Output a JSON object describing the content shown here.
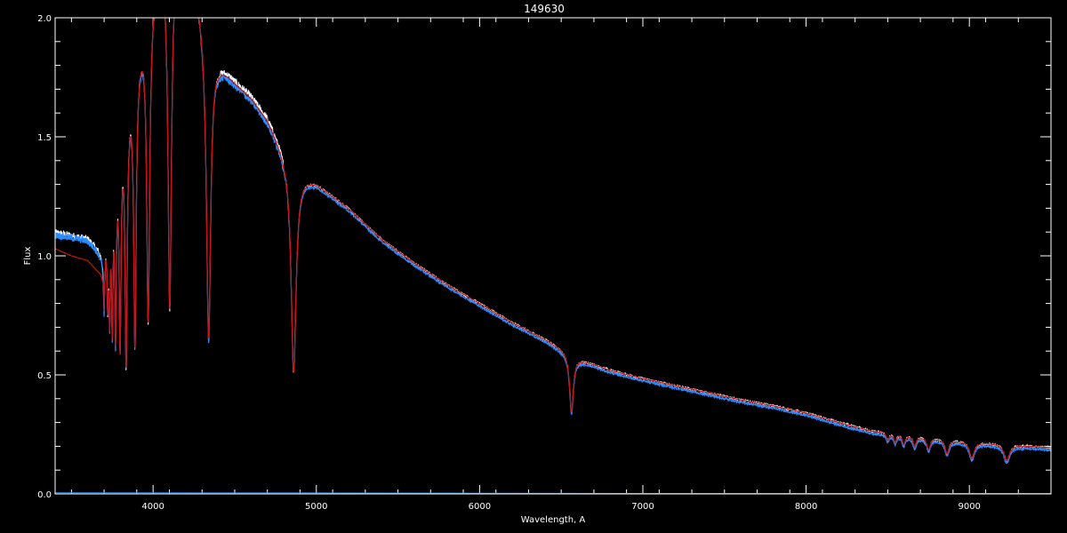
{
  "chart_data": {
    "type": "line",
    "title": "149630",
    "xlabel": "Wavelength, A",
    "ylabel": "Flux",
    "xlim": [
      3400,
      9500
    ],
    "ylim": [
      0.0,
      2.0
    ],
    "xticks": [
      4000,
      5000,
      6000,
      7000,
      8000,
      9000
    ],
    "yticks": [
      0.0,
      0.5,
      1.0,
      1.5,
      2.0
    ],
    "xtick_labels": [
      "4000",
      "5000",
      "6000",
      "7000",
      "8000",
      "9000"
    ],
    "ytick_labels": [
      "0.0",
      "0.5",
      "1.0",
      "1.5",
      "2.0"
    ],
    "grid": false,
    "colors": {
      "background": "#000000",
      "axes": "#ffffff",
      "observed": "#ffffff",
      "observed_alt": "#2a8cff",
      "model": "#cc1010"
    },
    "continuum": {
      "x": [
        3400,
        3600,
        3700,
        3720,
        3800,
        3900,
        4000,
        4100,
        4200,
        4300,
        4400,
        4500,
        4600,
        4700,
        4800,
        4900,
        5000,
        5200,
        5400,
        5600,
        5800,
        6000,
        6200,
        6400,
        6600,
        6800,
        7000,
        7200,
        7400,
        7600,
        7800,
        8000,
        8200,
        8400,
        8600,
        8800,
        9000,
        9200,
        9400,
        9500
      ],
      "y": [
        1.1,
        1.08,
        1.02,
        1.22,
        1.55,
        1.85,
        2.15,
        2.35,
        2.3,
        2.05,
        1.83,
        1.74,
        1.67,
        1.58,
        1.44,
        1.35,
        1.31,
        1.2,
        1.07,
        0.97,
        0.88,
        0.8,
        0.72,
        0.65,
        0.57,
        0.52,
        0.485,
        0.455,
        0.425,
        0.395,
        0.37,
        0.34,
        0.3,
        0.265,
        0.25,
        0.235,
        0.22,
        0.21,
        0.2,
        0.195
      ]
    },
    "model_blue_end": {
      "x": [
        3400,
        3500,
        3600,
        3680,
        3700
      ],
      "y": [
        1.03,
        1.0,
        0.98,
        0.92,
        0.87
      ]
    },
    "absorption_lines": [
      {
        "x": 3700,
        "depth": 0.2,
        "width": 5
      },
      {
        "x": 3722,
        "depth": 0.35,
        "width": 5
      },
      {
        "x": 3734,
        "depth": 0.45,
        "width": 5
      },
      {
        "x": 3750,
        "depth": 0.55,
        "width": 5
      },
      {
        "x": 3770,
        "depth": 0.68,
        "width": 6
      },
      {
        "x": 3798,
        "depth": 0.85,
        "width": 7
      },
      {
        "x": 3835,
        "depth": 1.05,
        "width": 8
      },
      {
        "x": 3889,
        "depth": 1.15,
        "width": 9
      },
      {
        "x": 3970,
        "depth": 1.3,
        "width": 11
      },
      {
        "x": 4102,
        "depth": 1.55,
        "width": 13
      },
      {
        "x": 4340,
        "depth": 1.3,
        "width": 16
      },
      {
        "x": 4861,
        "depth": 0.87,
        "width": 18
      },
      {
        "x": 6563,
        "depth": 0.24,
        "width": 14
      },
      {
        "x": 8500,
        "depth": 0.03,
        "width": 10
      },
      {
        "x": 8545,
        "depth": 0.035,
        "width": 10
      },
      {
        "x": 8598,
        "depth": 0.04,
        "width": 11
      },
      {
        "x": 8665,
        "depth": 0.045,
        "width": 12
      },
      {
        "x": 8750,
        "depth": 0.05,
        "width": 14
      },
      {
        "x": 8863,
        "depth": 0.06,
        "width": 16
      },
      {
        "x": 9015,
        "depth": 0.07,
        "width": 18
      },
      {
        "x": 9229,
        "depth": 0.07,
        "width": 20
      }
    ],
    "baseline": {
      "x": [
        3400,
        5000,
        6000,
        7000,
        9500
      ],
      "y": [
        0.005,
        0.004,
        0.003,
        0.002,
        0.002
      ]
    }
  }
}
